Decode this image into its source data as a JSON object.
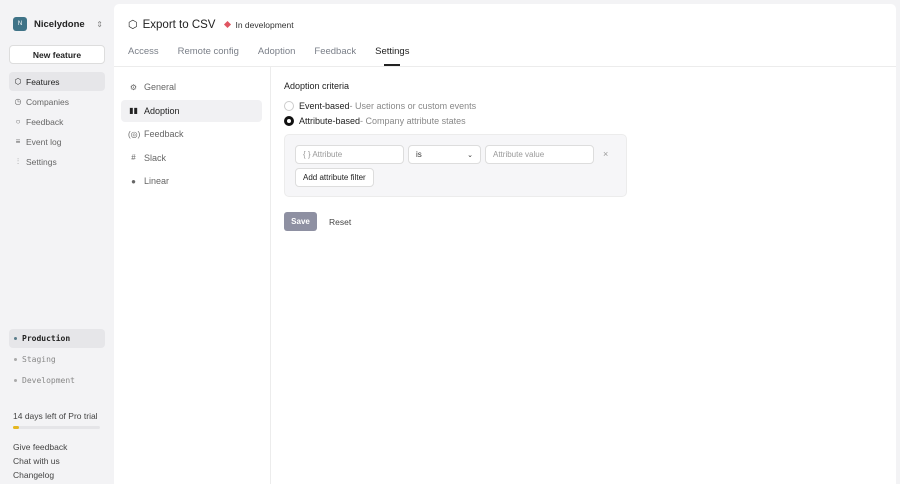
{
  "sidebar": {
    "org_initial": "N",
    "org_name": "Nicelydone",
    "new_feature": "New feature",
    "items": [
      {
        "label": "Features",
        "icon": "cube-icon"
      },
      {
        "label": "Companies",
        "icon": "clock-icon"
      },
      {
        "label": "Feedback",
        "icon": "chat-icon"
      },
      {
        "label": "Event log",
        "icon": "list-icon"
      },
      {
        "label": "Settings",
        "icon": "sliders-icon"
      }
    ],
    "environments": [
      "Production",
      "Staging",
      "Development"
    ],
    "trial_text": "14 days left of Pro trial",
    "trial_progress": 0.07,
    "links": [
      "Give feedback",
      "Chat with us",
      "Changelog"
    ]
  },
  "header": {
    "title": "Export to CSV",
    "status": "In development",
    "status_color": "#e05561",
    "tabs": [
      "Access",
      "Remote config",
      "Adoption",
      "Feedback",
      "Settings"
    ]
  },
  "settings_nav": [
    {
      "label": "General"
    },
    {
      "label": "Adoption"
    },
    {
      "label": "Feedback"
    },
    {
      "label": "Slack"
    },
    {
      "label": "Linear"
    }
  ],
  "adoption": {
    "heading": "Adoption criteria",
    "options": [
      {
        "label": "Event-based",
        "desc": " - User actions or custom events"
      },
      {
        "label": "Attribute-based",
        "desc": " - Company attribute states"
      }
    ],
    "attribute_placeholder": "{ }  Attribute",
    "operator": "is",
    "value_placeholder": "Attribute value",
    "add_filter": "Add attribute filter",
    "save": "Save",
    "reset": "Reset"
  }
}
